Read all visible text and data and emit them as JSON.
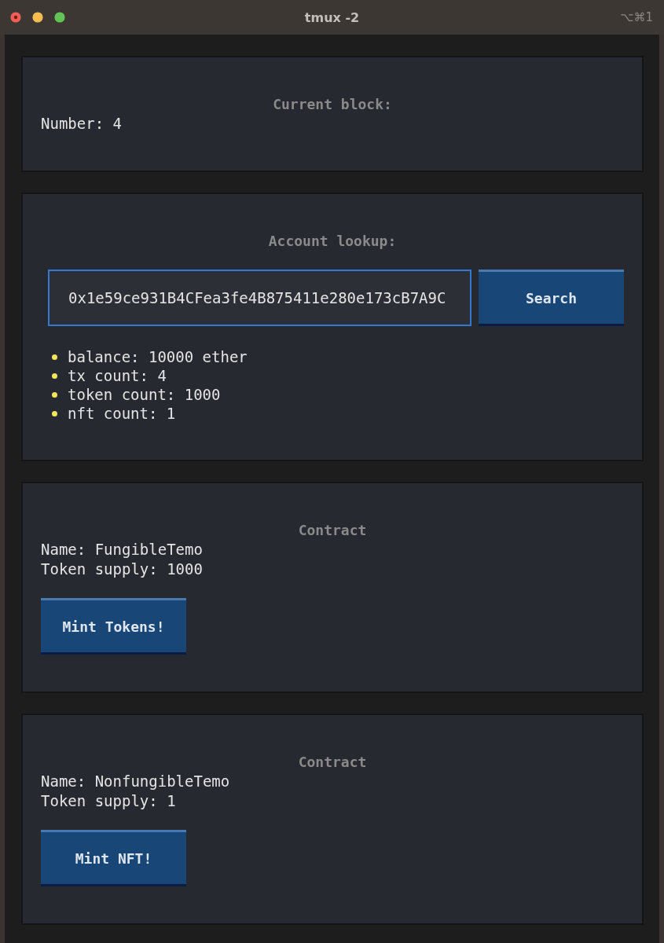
{
  "window": {
    "title": "tmux -2",
    "shortcut": "⌥⌘1"
  },
  "panels": [
    {
      "kind": "block",
      "heading": "Current block:",
      "lines": [
        "Number: 4"
      ]
    },
    {
      "kind": "lookup",
      "heading": "Account lookup:",
      "field": {
        "value": "0x1e59ce931B4CFea3fe4B875411e280e173cB7A9C"
      },
      "button": "Search",
      "items": [
        "balance: 10000 ether",
        "tx count: 4",
        "token count: 1000",
        "nft count: 1"
      ]
    },
    {
      "kind": "contract",
      "heading": "Contract",
      "lines": [
        "Name: FungibleTemo",
        "Token supply: 1000"
      ],
      "button": "Mint Tokens!"
    },
    {
      "kind": "contract",
      "heading": "Contract",
      "lines": [
        "Name: NonfungibleTemo",
        "Token supply: 1"
      ],
      "button": "Mint NFT!"
    }
  ]
}
